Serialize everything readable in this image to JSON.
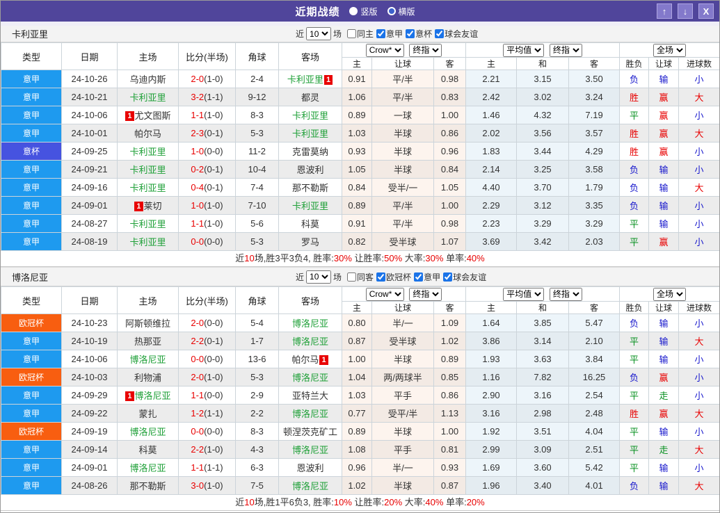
{
  "title_bar": {
    "title": "近期战绩",
    "radio_vertical": "竖版",
    "radio_horizontal": "横版",
    "up_button": "↑",
    "down_button": "↓",
    "close_button": "X"
  },
  "colors": {
    "titlebar_bg": "#50459B",
    "league": {
      "意甲": "#1E9AEF",
      "意杯": "#4653E0",
      "欧冠杯": "#F85E10"
    },
    "outcome": {
      "胜": "#e80000",
      "赢": "#e80000",
      "大": "#e80000",
      "平": "#089020",
      "走": "#089020",
      "负": "#1616cc",
      "输": "#1616cc",
      "小": "#1616cc"
    },
    "self_team": "#1fa038",
    "score_red": "#e80000"
  },
  "header": {
    "cols": [
      "类型",
      "日期",
      "主场",
      "比分(半场)",
      "角球",
      "客场"
    ],
    "crow_select": "Crow*",
    "crow_final_select": "终指",
    "avg_select": "平均值",
    "avg_final_select": "终指",
    "full_select": "全场",
    "crow_sub": [
      "主",
      "让球",
      "客"
    ],
    "avg_sub": [
      "主",
      "和",
      "客"
    ],
    "full_sub": [
      "胜负",
      "让球",
      "进球数"
    ]
  },
  "tables": [
    {
      "team": "卡利亚里",
      "filter": {
        "prefix": "近",
        "count": "10",
        "suffix": "场",
        "checks": [
          {
            "label": "同主",
            "checked": false
          },
          {
            "label": "意甲",
            "checked": true
          },
          {
            "label": "意杯",
            "checked": true
          },
          {
            "label": "球会友谊",
            "checked": true
          }
        ]
      },
      "rows": [
        {
          "lg": "意甲",
          "dt": "24-10-26",
          "hm": "乌迪内斯",
          "hmSelf": false,
          "hmRed": null,
          "ft": "2-0",
          "ht": "(1-0)",
          "cn": "2-4",
          "aw": "卡利亚里",
          "awSelf": true,
          "awRed": "1",
          "c1": "0.91",
          "hd": "平/半",
          "c2": "0.98",
          "a1": "2.21",
          "a2": "3.15",
          "a3": "3.50",
          "r1": "负",
          "r2": "输",
          "r3": "小"
        },
        {
          "lg": "意甲",
          "dt": "24-10-21",
          "hm": "卡利亚里",
          "hmSelf": true,
          "hmRed": null,
          "ft": "3-2",
          "ht": "(1-1)",
          "cn": "9-12",
          "aw": "都灵",
          "awSelf": false,
          "awRed": null,
          "c1": "1.06",
          "hd": "平/半",
          "c2": "0.83",
          "a1": "2.42",
          "a2": "3.02",
          "a3": "3.24",
          "r1": "胜",
          "r2": "赢",
          "r3": "大"
        },
        {
          "lg": "意甲",
          "dt": "24-10-06",
          "hm": "尤文图斯",
          "hmSelf": false,
          "hmRed": "1",
          "ft": "1-1",
          "ht": "(1-0)",
          "cn": "8-3",
          "aw": "卡利亚里",
          "awSelf": true,
          "awRed": null,
          "c1": "0.89",
          "hd": "一球",
          "c2": "1.00",
          "a1": "1.46",
          "a2": "4.32",
          "a3": "7.19",
          "r1": "平",
          "r2": "赢",
          "r3": "小"
        },
        {
          "lg": "意甲",
          "dt": "24-10-01",
          "hm": "帕尔马",
          "hmSelf": false,
          "hmRed": null,
          "ft": "2-3",
          "ht": "(0-1)",
          "cn": "5-3",
          "aw": "卡利亚里",
          "awSelf": true,
          "awRed": null,
          "c1": "1.03",
          "hd": "半球",
          "c2": "0.86",
          "a1": "2.02",
          "a2": "3.56",
          "a3": "3.57",
          "r1": "胜",
          "r2": "赢",
          "r3": "大"
        },
        {
          "lg": "意杯",
          "dt": "24-09-25",
          "hm": "卡利亚里",
          "hmSelf": true,
          "hmRed": null,
          "ft": "1-0",
          "ht": "(0-0)",
          "cn": "11-2",
          "aw": "克雷莫纳",
          "awSelf": false,
          "awRed": null,
          "c1": "0.93",
          "hd": "半球",
          "c2": "0.96",
          "a1": "1.83",
          "a2": "3.44",
          "a3": "4.29",
          "r1": "胜",
          "r2": "赢",
          "r3": "小"
        },
        {
          "lg": "意甲",
          "dt": "24-09-21",
          "hm": "卡利亚里",
          "hmSelf": true,
          "hmRed": null,
          "ft": "0-2",
          "ht": "(0-1)",
          "cn": "10-4",
          "aw": "恩波利",
          "awSelf": false,
          "awRed": null,
          "c1": "1.05",
          "hd": "半球",
          "c2": "0.84",
          "a1": "2.14",
          "a2": "3.25",
          "a3": "3.58",
          "r1": "负",
          "r2": "输",
          "r3": "小"
        },
        {
          "lg": "意甲",
          "dt": "24-09-16",
          "hm": "卡利亚里",
          "hmSelf": true,
          "hmRed": null,
          "ft": "0-4",
          "ht": "(0-1)",
          "cn": "7-4",
          "aw": "那不勒斯",
          "awSelf": false,
          "awRed": null,
          "c1": "0.84",
          "hd": "受半/一",
          "c2": "1.05",
          "a1": "4.40",
          "a2": "3.70",
          "a3": "1.79",
          "r1": "负",
          "r2": "输",
          "r3": "大"
        },
        {
          "lg": "意甲",
          "dt": "24-09-01",
          "hm": "莱切",
          "hmSelf": false,
          "hmRed": "1",
          "ft": "1-0",
          "ht": "(1-0)",
          "cn": "7-10",
          "aw": "卡利亚里",
          "awSelf": true,
          "awRed": null,
          "c1": "0.89",
          "hd": "平/半",
          "c2": "1.00",
          "a1": "2.29",
          "a2": "3.12",
          "a3": "3.35",
          "r1": "负",
          "r2": "输",
          "r3": "小"
        },
        {
          "lg": "意甲",
          "dt": "24-08-27",
          "hm": "卡利亚里",
          "hmSelf": true,
          "hmRed": null,
          "ft": "1-1",
          "ht": "(1-0)",
          "cn": "5-6",
          "aw": "科莫",
          "awSelf": false,
          "awRed": null,
          "c1": "0.91",
          "hd": "平/半",
          "c2": "0.98",
          "a1": "2.23",
          "a2": "3.29",
          "a3": "3.29",
          "r1": "平",
          "r2": "输",
          "r3": "小"
        },
        {
          "lg": "意甲",
          "dt": "24-08-19",
          "hm": "卡利亚里",
          "hmSelf": true,
          "hmRed": null,
          "ft": "0-0",
          "ht": "(0-0)",
          "cn": "5-3",
          "aw": "罗马",
          "awSelf": false,
          "awRed": null,
          "c1": "0.82",
          "hd": "受半球",
          "c2": "1.07",
          "a1": "3.69",
          "a2": "3.42",
          "a3": "2.03",
          "r1": "平",
          "r2": "赢",
          "r3": "小"
        }
      ],
      "summary": [
        [
          "近",
          0
        ],
        [
          "10",
          1
        ],
        [
          "场,胜3平3负4, 胜率:",
          0
        ],
        [
          "30%",
          1
        ],
        [
          " 让胜率:",
          0
        ],
        [
          "50%",
          1
        ],
        [
          " 大率:",
          0
        ],
        [
          "30%",
          1
        ],
        [
          " 单率:",
          0
        ],
        [
          "40%",
          1
        ]
      ]
    },
    {
      "team": "博洛尼亚",
      "filter": {
        "prefix": "近",
        "count": "10",
        "suffix": "场",
        "checks": [
          {
            "label": "同客",
            "checked": false
          },
          {
            "label": "欧冠杯",
            "checked": true
          },
          {
            "label": "意甲",
            "checked": true
          },
          {
            "label": "球会友谊",
            "checked": true
          }
        ]
      },
      "rows": [
        {
          "lg": "欧冠杯",
          "dt": "24-10-23",
          "hm": "阿斯顿维拉",
          "hmSelf": false,
          "hmRed": null,
          "ft": "2-0",
          "ht": "(0-0)",
          "cn": "5-4",
          "aw": "博洛尼亚",
          "awSelf": true,
          "awRed": null,
          "c1": "0.80",
          "hd": "半/一",
          "c2": "1.09",
          "a1": "1.64",
          "a2": "3.85",
          "a3": "5.47",
          "r1": "负",
          "r2": "输",
          "r3": "小"
        },
        {
          "lg": "意甲",
          "dt": "24-10-19",
          "hm": "热那亚",
          "hmSelf": false,
          "hmRed": null,
          "ft": "2-2",
          "ht": "(0-1)",
          "cn": "1-7",
          "aw": "博洛尼亚",
          "awSelf": true,
          "awRed": null,
          "c1": "0.87",
          "hd": "受半球",
          "c2": "1.02",
          "a1": "3.86",
          "a2": "3.14",
          "a3": "2.10",
          "r1": "平",
          "r2": "输",
          "r3": "大"
        },
        {
          "lg": "意甲",
          "dt": "24-10-06",
          "hm": "博洛尼亚",
          "hmSelf": true,
          "hmRed": null,
          "ft": "0-0",
          "ht": "(0-0)",
          "cn": "13-6",
          "aw": "帕尔马",
          "awSelf": false,
          "awRed": "1",
          "c1": "1.00",
          "hd": "半球",
          "c2": "0.89",
          "a1": "1.93",
          "a2": "3.63",
          "a3": "3.84",
          "r1": "平",
          "r2": "输",
          "r3": "小"
        },
        {
          "lg": "欧冠杯",
          "dt": "24-10-03",
          "hm": "利物浦",
          "hmSelf": false,
          "hmRed": null,
          "ft": "2-0",
          "ht": "(1-0)",
          "cn": "5-3",
          "aw": "博洛尼亚",
          "awSelf": true,
          "awRed": null,
          "c1": "1.04",
          "hd": "两/两球半",
          "c2": "0.85",
          "a1": "1.16",
          "a2": "7.82",
          "a3": "16.25",
          "r1": "负",
          "r2": "赢",
          "r3": "小"
        },
        {
          "lg": "意甲",
          "dt": "24-09-29",
          "hm": "博洛尼亚",
          "hmSelf": true,
          "hmRed": "1",
          "ft": "1-1",
          "ht": "(0-0)",
          "cn": "2-9",
          "aw": "亚特兰大",
          "awSelf": false,
          "awRed": null,
          "c1": "1.03",
          "hd": "平手",
          "c2": "0.86",
          "a1": "2.90",
          "a2": "3.16",
          "a3": "2.54",
          "r1": "平",
          "r2": "走",
          "r3": "小"
        },
        {
          "lg": "意甲",
          "dt": "24-09-22",
          "hm": "蒙扎",
          "hmSelf": false,
          "hmRed": null,
          "ft": "1-2",
          "ht": "(1-1)",
          "cn": "2-2",
          "aw": "博洛尼亚",
          "awSelf": true,
          "awRed": null,
          "c1": "0.77",
          "hd": "受平/半",
          "c2": "1.13",
          "a1": "3.16",
          "a2": "2.98",
          "a3": "2.48",
          "r1": "胜",
          "r2": "赢",
          "r3": "大"
        },
        {
          "lg": "欧冠杯",
          "dt": "24-09-19",
          "hm": "博洛尼亚",
          "hmSelf": true,
          "hmRed": null,
          "ft": "0-0",
          "ht": "(0-0)",
          "cn": "8-3",
          "aw": "顿涅茨克矿工",
          "awSelf": false,
          "awRed": null,
          "c1": "0.89",
          "hd": "半球",
          "c2": "1.00",
          "a1": "1.92",
          "a2": "3.51",
          "a3": "4.04",
          "r1": "平",
          "r2": "输",
          "r3": "小"
        },
        {
          "lg": "意甲",
          "dt": "24-09-14",
          "hm": "科莫",
          "hmSelf": false,
          "hmRed": null,
          "ft": "2-2",
          "ht": "(1-0)",
          "cn": "4-3",
          "aw": "博洛尼亚",
          "awSelf": true,
          "awRed": null,
          "c1": "1.08",
          "hd": "平手",
          "c2": "0.81",
          "a1": "2.99",
          "a2": "3.09",
          "a3": "2.51",
          "r1": "平",
          "r2": "走",
          "r3": "大"
        },
        {
          "lg": "意甲",
          "dt": "24-09-01",
          "hm": "博洛尼亚",
          "hmSelf": true,
          "hmRed": null,
          "ft": "1-1",
          "ht": "(1-1)",
          "cn": "6-3",
          "aw": "恩波利",
          "awSelf": false,
          "awRed": null,
          "c1": "0.96",
          "hd": "半/一",
          "c2": "0.93",
          "a1": "1.69",
          "a2": "3.60",
          "a3": "5.42",
          "r1": "平",
          "r2": "输",
          "r3": "小"
        },
        {
          "lg": "意甲",
          "dt": "24-08-26",
          "hm": "那不勒斯",
          "hmSelf": false,
          "hmRed": null,
          "ft": "3-0",
          "ht": "(1-0)",
          "cn": "7-5",
          "aw": "博洛尼亚",
          "awSelf": true,
          "awRed": null,
          "c1": "1.02",
          "hd": "半球",
          "c2": "0.87",
          "a1": "1.96",
          "a2": "3.40",
          "a3": "4.01",
          "r1": "负",
          "r2": "输",
          "r3": "大"
        }
      ],
      "summary": [
        [
          "近",
          0
        ],
        [
          "10",
          1
        ],
        [
          "场,胜1平6负3, 胜率:",
          0
        ],
        [
          "10%",
          1
        ],
        [
          " 让胜率:",
          0
        ],
        [
          "20%",
          1
        ],
        [
          " 大率:",
          0
        ],
        [
          "40%",
          1
        ],
        [
          " 单率:",
          0
        ],
        [
          "20%",
          1
        ]
      ]
    }
  ]
}
